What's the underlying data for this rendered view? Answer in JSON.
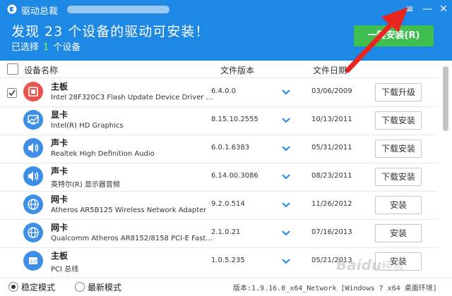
{
  "window": {
    "title": "驱动总裁",
    "menu_icon": "≡",
    "minimize_icon": "—",
    "close_icon": "✕"
  },
  "banner": {
    "headline": "发现 23 个设备的驱动可安装！",
    "selected_prefix": "已选择",
    "selected_count": "1",
    "selected_suffix": "个设备",
    "install_label": "一键安装(R)"
  },
  "columns": {
    "device": "设备名称",
    "version": "文件版本",
    "date": "文件日期"
  },
  "devices": [
    {
      "category": "主板",
      "name": "Intel 28F320C3 Flash Update Device Driver v...",
      "version": "6.4.0.0",
      "date": "03/06/2009",
      "action": "下载升级",
      "icon": "motherboard-icon",
      "color": "#e8554e",
      "checked": true
    },
    {
      "category": "显卡",
      "name": "Intel(R) HD Graphics",
      "version": "8.15.10.2555",
      "date": "10/13/2011",
      "action": "下载安装",
      "icon": "display-icon",
      "color": "#3d8ee6",
      "checked": false
    },
    {
      "category": "声卡",
      "name": "Realtek High Definition Audio",
      "version": "6.0.1.6383",
      "date": "05/31/2011",
      "action": "下载安装",
      "icon": "speaker-icon",
      "color": "#3d8ee6",
      "checked": false
    },
    {
      "category": "声卡",
      "name": "英特尔(R) 显示器音频",
      "version": "6.14.00.3086",
      "date": "08/23/2011",
      "action": "下载安装",
      "icon": "speaker-icon",
      "color": "#3d8ee6",
      "checked": false
    },
    {
      "category": "网卡",
      "name": "Atheros AR5B125 Wireless Network Adapter",
      "version": "9.2.0.514",
      "date": "11/26/2012",
      "action": "安装",
      "icon": "globe-icon",
      "color": "#3d8ee6",
      "checked": false
    },
    {
      "category": "网卡",
      "name": "Qualcomm Atheros AR8152/8158 PCI-E Fast Eth...",
      "version": "2.1.0.21",
      "date": "07/16/2013",
      "action": "安装",
      "icon": "globe-icon",
      "color": "#3d8ee6",
      "checked": false
    },
    {
      "category": "主板",
      "name": "PCI 总线",
      "version": "1.0.5.235",
      "date": "05/21/2013",
      "action": "安装",
      "icon": "usb3-icon",
      "color": "#3d8ee6",
      "checked": false
    }
  ],
  "footer": {
    "mode_stable": "稳定模式",
    "mode_latest": "最新模式",
    "version_text": "版本:1.9.16.0_x64_Network [Windows 7 x64 桌面环境]"
  },
  "watermark": "Baidu经验",
  "colors": {
    "header": "#1e88e5",
    "install": "#3fbf4f",
    "arrow": "#e8251e",
    "selected_count": "#7cff4a"
  }
}
